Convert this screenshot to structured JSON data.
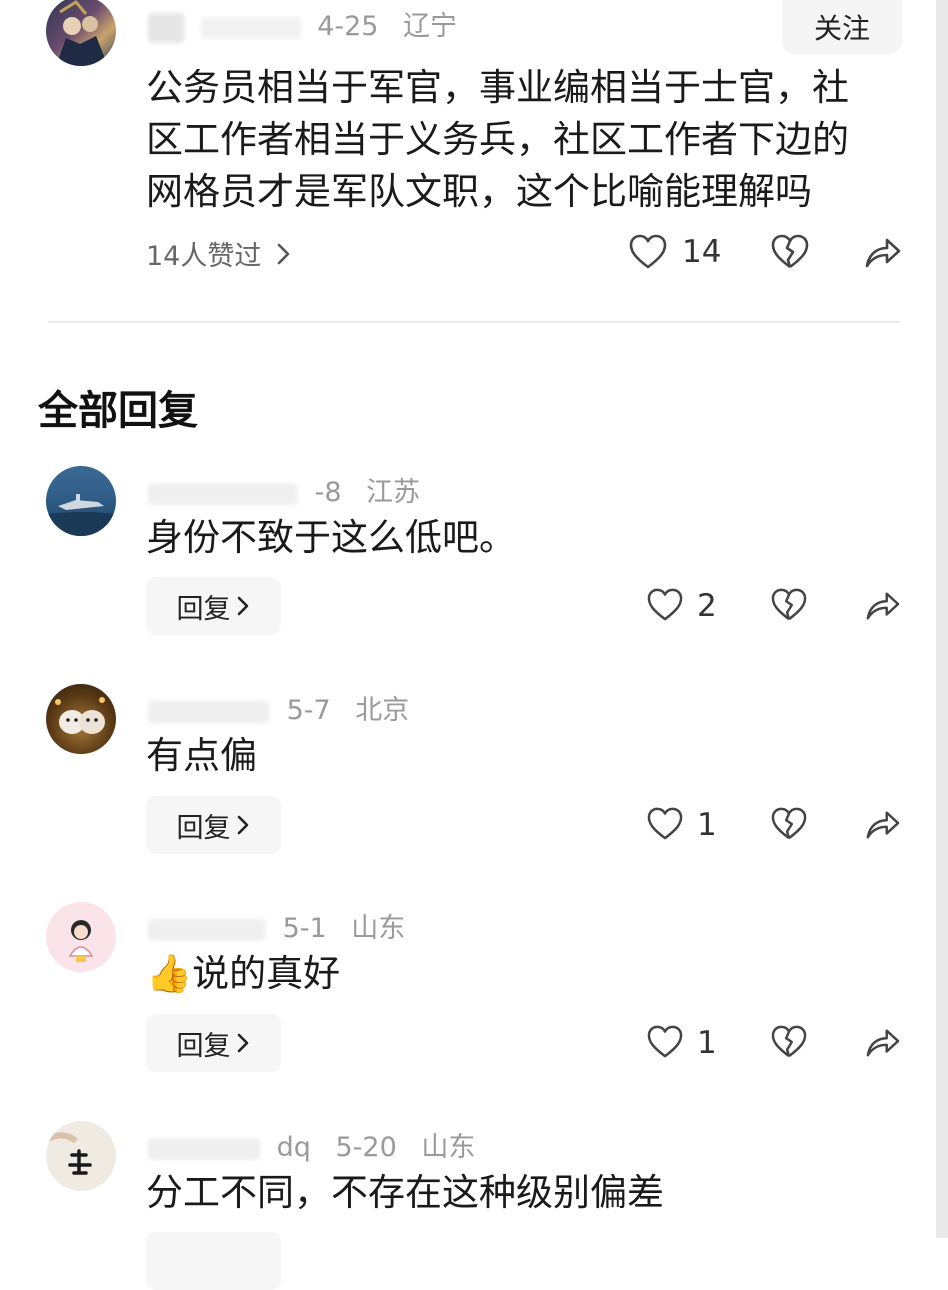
{
  "post": {
    "date": "4-25",
    "location": "辽宁",
    "follow_label": "关注",
    "text": [
      "公务员相当于军官，事业编相当于士官，社",
      "区工作者相当于义务兵，社区工作者下边的",
      "网格员才是军队文职，这个比喻能理解吗"
    ],
    "likes_summary": "14人赞过",
    "like_count": "14"
  },
  "section_title": "全部回复",
  "reply_label": "回复",
  "replies": [
    {
      "date": "-8",
      "location": "江苏",
      "text": "身份不致于这么低吧。",
      "like_count": "2"
    },
    {
      "date": "5-7",
      "location": "北京",
      "text": "有点偏",
      "like_count": "1"
    },
    {
      "date": "5-1",
      "location": "山东",
      "emoji": "👍",
      "text": "说的真好",
      "like_count": "1"
    },
    {
      "name_fragment": "dq",
      "date": "5-20",
      "location": "山东",
      "text": "分工不同，不存在这种级别偏差"
    }
  ],
  "icons": {
    "like": "heart-outline-icon",
    "dislike": "broken-heart-icon",
    "share": "share-arrow-icon",
    "chevron": "chevron-right-icon"
  }
}
